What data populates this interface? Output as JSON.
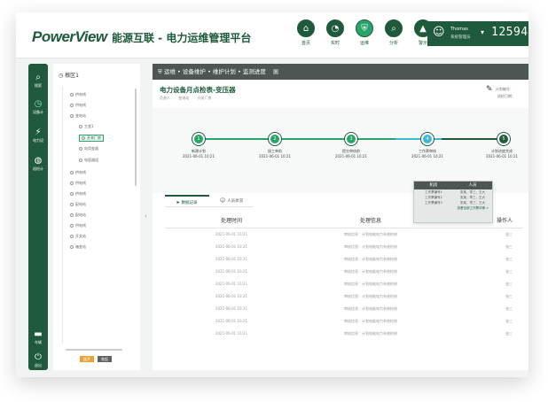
{
  "header": {
    "logo": "PowerView",
    "subtitle": "能源互联 - 电力运维管理平台",
    "nav": [
      {
        "label": "首页",
        "icon": "home-icon",
        "glyph": "⌂"
      },
      {
        "label": "实时",
        "icon": "gauge-icon",
        "glyph": "◔"
      },
      {
        "label": "运维",
        "icon": "shield-icon",
        "glyph": "⛨"
      },
      {
        "label": "分析",
        "icon": "magnifier-icon",
        "glyph": "⌕"
      },
      {
        "label": "警示",
        "icon": "warning-icon",
        "glyph": "▲"
      }
    ],
    "user": {
      "name": "Thomas",
      "role": "系统管理员",
      "clock": "12594:"
    }
  },
  "rail": [
    {
      "label": "搜索",
      "icon": "search-icon",
      "glyph": "⌕"
    },
    {
      "label": "设备计",
      "icon": "clock-icon",
      "glyph": "◷"
    },
    {
      "label": "电力设",
      "icon": "tower-icon",
      "glyph": "⚡"
    },
    {
      "label": "巡检计",
      "icon": "globe-icon",
      "glyph": "◍"
    },
    {
      "label": "车辆",
      "icon": "car-icon",
      "glyph": "▬"
    },
    {
      "label": "退出",
      "icon": "exit-icon",
      "glyph": "⏻"
    }
  ],
  "tree": {
    "title": "根区1",
    "nodes": [
      "供电线",
      "供电线",
      "变电站",
      "主变1",
      "开关厂房",
      "站用变器",
      "电容器组",
      "供电线",
      "供电线",
      "供电线",
      "配电站",
      "配电站",
      "供电线",
      "开关站",
      "箱变站"
    ],
    "buttons": [
      "展开",
      "收起"
    ],
    "button_colors": [
      "#e8a23a",
      "#5c6360"
    ]
  },
  "main": {
    "breadcrumb": "运维 • 设备维护 • 维护计划 • 监测进度",
    "breadcrumb_close": "×",
    "title": "电力设备月点检表-变压器",
    "meta": [
      "负责人",
      "变电站",
      "开关厂房"
    ],
    "topright": [
      "计划编号：",
      "巡检日期："
    ],
    "timeline": [
      {
        "step": "1",
        "name": "新建计划",
        "date": "2021-06-01 10:21"
      },
      {
        "step": "2",
        "name": "接工单前",
        "date": "2021-06-01 10:21"
      },
      {
        "step": "3",
        "name": "提交审核前",
        "date": "2021-06-01 10:21"
      },
      {
        "step": "4",
        "name": "工作票审核",
        "date": "2021-06-01 10:21"
      },
      {
        "step": "5",
        "name": "计划进度完成",
        "date": "2021-06-01 10:21"
      }
    ],
    "popup": {
      "headers": [
        "机房",
        "人员"
      ],
      "rows": [
        [
          "工作票编号1",
          "张某，李三，王大"
        ],
        [
          "工作票编号2",
          "张某，李三，王大"
        ],
        [
          "工作票编号3",
          "张某，李三，王大"
        ]
      ],
      "more": "查看全部工作票详情 >"
    },
    "tabs": [
      {
        "label": "数据记录",
        "icon": "cursor-icon",
        "glyph": "▸"
      },
      {
        "label": "人员状况",
        "icon": "people-icon",
        "glyph": "☺"
      }
    ],
    "table": {
      "headers": [
        "处理时间",
        "处理信息",
        "操作人"
      ],
      "rows": [
        [
          "2021-06-01  10:21",
          "审核信息：计划电能电力系统检修",
          "张三"
        ],
        [
          "2021-06-01  10:21",
          "审核信息：计划电能电力系统检修",
          "张三"
        ],
        [
          "2021-06-01  10:21",
          "审核信息：计划电能电力系统检修",
          "张三"
        ],
        [
          "2021-06-01  10:21",
          "审核信息：计划电能电力系统检修",
          "张三"
        ],
        [
          "2021-06-01  10:21",
          "审核信息：计划电能电力系统检修",
          "张三"
        ],
        [
          "2021-06-01  10:21",
          "审核信息：计划电能电力系统检修",
          "张三"
        ],
        [
          "2021-06-01  10:21",
          "审核信息：计划电能电力系统检修",
          "张三"
        ],
        [
          "2021-06-01  10:21",
          "审核信息：计划电能电力系统检修",
          "张三"
        ],
        [
          "2021-06-01  10:21",
          "审核信息：计划电能电力系统检修",
          "张三"
        ]
      ]
    }
  },
  "colors": {
    "brand": "#1e5a3b",
    "accent": "#27a56b",
    "current": "#3fb8d6",
    "dark_bar": "#4e5552"
  }
}
